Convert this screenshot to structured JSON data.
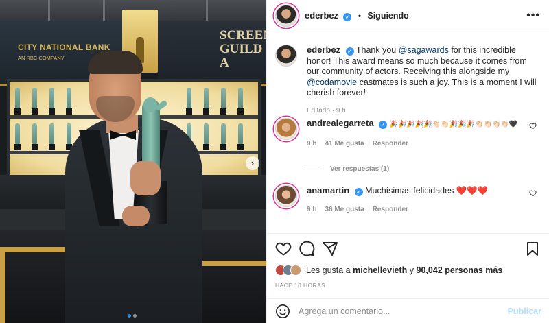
{
  "photo": {
    "bank_sign": "CITY NATIONAL BANK",
    "bank_sub": "AN RBC COMPANY",
    "sag_sign_line1": "SCREEN",
    "sag_sign_line2": "GUILD A",
    "next_arrow": "›",
    "carousel_dots": 2,
    "carousel_active": 1
  },
  "header": {
    "username": "ederbez",
    "verified_glyph": "✓",
    "separator": "•",
    "follow_status": "Siguiendo",
    "more": "•••"
  },
  "caption": {
    "username": "ederbez",
    "text_part1": " Thank you ",
    "mention1": "@sagawards",
    "text_part2": " for this incredible honor! This award means so much because it comes from our community of actors. Receiving this alongside my ",
    "mention2": "@codamovie",
    "text_part3": " castmates is such a joy. This is a moment I will cherish forever!",
    "edited": "Editado",
    "dot": "·",
    "time": "9 h"
  },
  "comments": [
    {
      "username": "andrealegarreta",
      "text": "🎉🎉🎉🎉🎉👏🏻👏🏻🎉🎉🎉👏🏻👏🏻👏🏻👏🏻🖤",
      "time": "9 h",
      "likes": "41 Me gusta",
      "reply": "Responder",
      "view_replies": "Ver respuestas (1)"
    },
    {
      "username": "anamartin",
      "text": "Muchísimas felicidades ❤️❤️❤️",
      "time": "9 h",
      "likes": "36 Me gusta",
      "reply": "Responder"
    }
  ],
  "actions": {
    "liked_by_prefix": "Les gusta a ",
    "liked_by_user": "michellevieth",
    "liked_by_mid": " y ",
    "liked_by_count": "90,042 personas más",
    "posted": "HACE 10 HORAS"
  },
  "add_comment": {
    "placeholder": "Agrega un comentario...",
    "post_label": "Publicar"
  },
  "colors": {
    "accent": "#3897f0",
    "mention": "#00376b",
    "muted": "#8e8e8e",
    "post_disabled": "#b2dffc",
    "story_ring": "#d8318f"
  },
  "icons": [
    "heart-icon",
    "comment-icon",
    "share-icon",
    "bookmark-icon",
    "emoji-icon",
    "more-icon",
    "verified-icon"
  ]
}
